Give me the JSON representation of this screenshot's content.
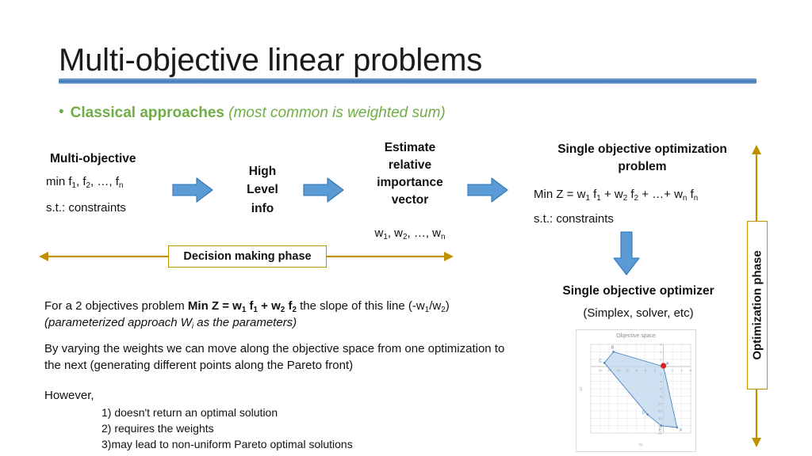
{
  "slide": {
    "title": "Multi-objective linear problems",
    "bullet": {
      "marker": "bullet-dot",
      "bold_text": "Classical approaches",
      "italic_text": "(most common is weighted sum)"
    },
    "colors": {
      "title_rule": "#4A7EBB",
      "bullet_green": "#70AD47",
      "arrow_blue": "#5B9BD5",
      "arrow_blue_border": "#2E75B6",
      "gold": "#BF9000",
      "chart_blue": "#4F81BD",
      "chart_fill": "#BDD7EE",
      "chart_red": "#E02020"
    }
  },
  "flow": {
    "stage1": {
      "heading": "Multi-objective",
      "line1_prefix": "min f",
      "line1": "min f1, f2, …, fn",
      "line2": "s.t.: constraints"
    },
    "arrow1_name": "right-arrow-1",
    "stage2": {
      "line1": "High",
      "line2": "Level",
      "line3": "info"
    },
    "arrow2_name": "right-arrow-2",
    "stage3": {
      "line1": "Estimate",
      "line2": "relative",
      "line3": "importance",
      "line4": "vector",
      "weights": "w1, w2, …, wn"
    },
    "arrow3_name": "right-arrow-3",
    "stage4": {
      "heading_line1": "Single objective optimization",
      "heading_line2": "problem",
      "objective": "Min Z = w1 f1 + w2 f2 + …+ wn fn",
      "constraints": "s.t.: constraints"
    },
    "down_arrow_name": "down-arrow",
    "optimizer": {
      "heading": "Single objective optimizer",
      "subtitle": "(Simplex, solver, etc)"
    }
  },
  "phases": {
    "decision": "Decision making phase",
    "optimization": "Optimization phase"
  },
  "body": {
    "para1_a": "For a 2 objectives problem ",
    "para1_bold": "Min Z = w1 f1 + w2 f2",
    "para1_b": " the slope of this line (-w1/w2)",
    "para1_italic": "(parameterized approach Wi as the parameters)",
    "para2": "By varying the weights we can move along the objective space from one optimization to the next (generating different points along the Pareto front)",
    "para3": "However,",
    "list": [
      "1) doesn't return an optimal solution",
      "2) requires the weights",
      "3)may lead to non-uniform Pareto optimal solutions"
    ]
  },
  "chart_data": {
    "type": "scatter",
    "title": "Objective space",
    "xlabel": "z1",
    "ylabel": "z2",
    "xlim": [
      -16,
      6
    ],
    "ylim": [
      -18,
      6
    ],
    "xticks": [
      -14,
      -12,
      -10,
      -8,
      -6,
      -4,
      -2,
      2,
      4,
      6
    ],
    "yticks": [
      6,
      4,
      2,
      -2,
      -4,
      -6,
      -8,
      -10,
      -12,
      -14,
      -16,
      -18
    ],
    "grid": true,
    "legend": "none",
    "polygon_labels": [
      "A",
      "B",
      "C",
      "D",
      "E",
      "F"
    ],
    "polygon_points": [
      {
        "label": "A",
        "x": 0,
        "y": 0
      },
      {
        "label": "B",
        "x": -11,
        "y": 4
      },
      {
        "label": "C",
        "x": -13,
        "y": 1
      },
      {
        "label": "D",
        "x": -3.5,
        "y": -13
      },
      {
        "label": "E",
        "x": -0.5,
        "y": -16
      },
      {
        "label": "F",
        "x": 3,
        "y": -16.5
      }
    ],
    "highlight_point": {
      "label": "A",
      "x": 0,
      "y": 0,
      "color": "#E02020"
    }
  }
}
